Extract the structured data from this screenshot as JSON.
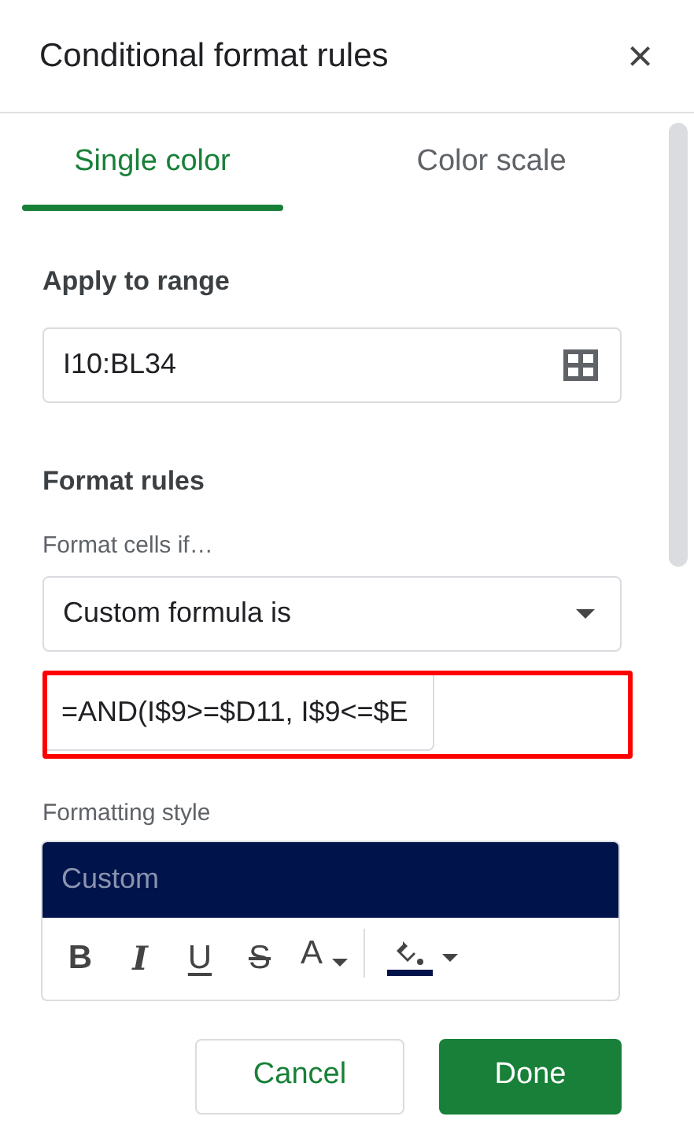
{
  "dialog": {
    "title": "Conditional format rules",
    "close": "×"
  },
  "tabs": [
    {
      "label": "Single color",
      "selected": true
    },
    {
      "label": "Color scale",
      "selected": false
    }
  ],
  "apply_to_range": {
    "label": "Apply to range",
    "value": "I10:BL34"
  },
  "format_rules": {
    "label": "Format rules",
    "condition_label": "Format cells if…",
    "condition": "Custom formula is",
    "formula": "=AND(I$9>=$D11, I$9<=$E",
    "formula_highlighted": true
  },
  "formatting_style": {
    "label": "Formatting style",
    "preview": "Custom",
    "toolbar": [
      {
        "kind": "bold",
        "label": "B"
      },
      {
        "kind": "italic",
        "label": "I"
      },
      {
        "kind": "underline",
        "label": "U"
      },
      {
        "kind": "strikethrough",
        "label": "S"
      },
      {
        "kind": "text_color",
        "label": "A"
      },
      {
        "kind": "fill_color"
      }
    ]
  },
  "buttons": [
    {
      "label": "Cancel",
      "kind": "secondary"
    },
    {
      "label": "Done",
      "kind": "primary"
    }
  ]
}
